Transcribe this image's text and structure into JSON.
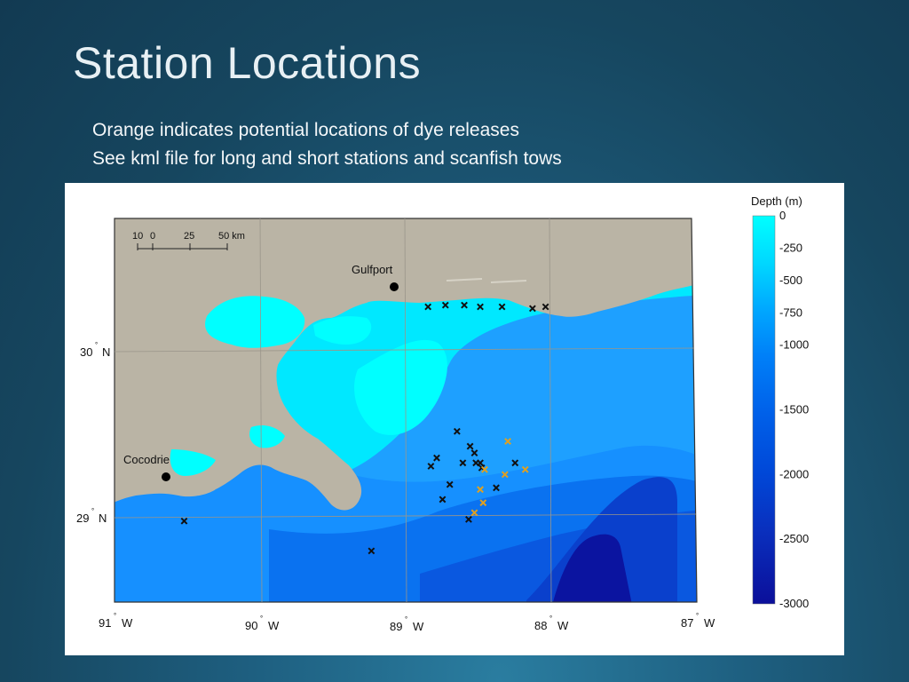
{
  "slide": {
    "title": "Station Locations",
    "subtitle_lines": [
      "Orange indicates potential  locations of dye releases",
      "See kml file for long and short stations and scanfish tows"
    ]
  },
  "map": {
    "colors": {
      "land": "#bab4a5",
      "shelf": "#00ffff",
      "deep": "#0b0f9a",
      "marker_black": "#111111",
      "marker_orange": "#e0a020"
    },
    "cities": [
      {
        "name": "Gulfport"
      },
      {
        "name": "Cocodrie"
      }
    ],
    "scale_bar": {
      "labels": [
        "10",
        "0",
        "25",
        "50 km"
      ]
    },
    "lat_labels": [
      "30",
      "N",
      "29",
      "N"
    ],
    "lon_labels": [
      "91",
      "W",
      "90",
      "W",
      "89",
      "W",
      "88",
      "W",
      "87",
      "W"
    ],
    "colorbar": {
      "title": "Depth (m)",
      "ticks": [
        "0",
        "-250",
        "-500",
        "-750",
        "-1000",
        "-1500",
        "-2000",
        "-2500",
        "-3000"
      ]
    },
    "stations": {
      "black": [
        [
          -88.84,
          30.27
        ],
        [
          -88.72,
          30.28
        ],
        [
          -88.59,
          30.28
        ],
        [
          -88.48,
          30.27
        ],
        [
          -88.33,
          30.27
        ],
        [
          -88.12,
          30.26
        ],
        [
          -88.03,
          30.27
        ],
        [
          -88.64,
          29.52
        ],
        [
          -88.55,
          29.43
        ],
        [
          -88.52,
          29.39
        ],
        [
          -88.78,
          29.36
        ],
        [
          -88.6,
          29.33
        ],
        [
          -88.51,
          29.33
        ],
        [
          -88.48,
          29.33
        ],
        [
          -88.47,
          29.3
        ],
        [
          -88.24,
          29.33
        ],
        [
          -88.82,
          29.31
        ],
        [
          -88.69,
          29.2
        ],
        [
          -88.37,
          29.18
        ],
        [
          -88.74,
          29.11
        ],
        [
          -88.56,
          28.99
        ],
        [
          -90.52,
          28.98
        ],
        [
          -89.23,
          28.8
        ]
      ],
      "orange": [
        [
          -88.29,
          29.46
        ],
        [
          -88.45,
          29.29
        ],
        [
          -88.31,
          29.26
        ],
        [
          -88.17,
          29.29
        ],
        [
          -88.48,
          29.17
        ],
        [
          -88.46,
          29.09
        ],
        [
          -88.52,
          29.03
        ]
      ]
    }
  }
}
